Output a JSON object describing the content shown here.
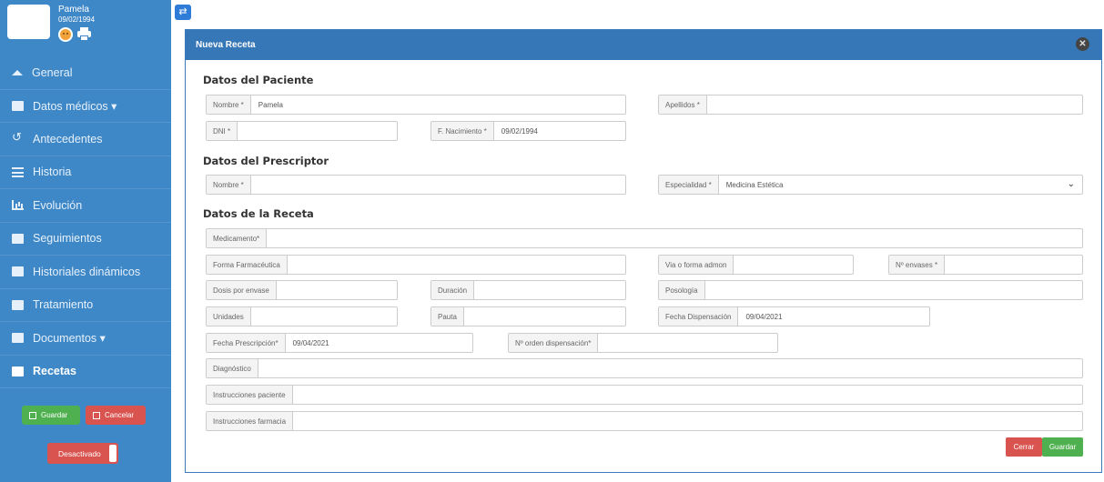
{
  "sidebar": {
    "patient_name": "Pamela",
    "patient_dob": "09/02/1994",
    "nav": [
      {
        "label": "General",
        "icon": "home-icon"
      },
      {
        "label": "Datos médicos ▾",
        "icon": "medkit-icon"
      },
      {
        "label": "Antecedentes",
        "icon": "history-icon"
      },
      {
        "label": "Historia",
        "icon": "list-icon"
      },
      {
        "label": "Evolución",
        "icon": "bar-chart-icon"
      },
      {
        "label": "Seguimientos",
        "icon": "calendar-icon"
      },
      {
        "label": "Historiales dinámicos",
        "icon": "file-icon"
      },
      {
        "label": "Tratamiento",
        "icon": "file-icon"
      },
      {
        "label": "Documentos ▾",
        "icon": "file-icon"
      },
      {
        "label": "Recetas",
        "icon": "card-icon"
      }
    ],
    "save_label": "Guardar",
    "cancel_label": "Cancelar",
    "toggle_label": "Desactivado"
  },
  "modal": {
    "title": "Nueva Receta",
    "section_patient": "Datos del Paciente",
    "section_prescriber": "Datos del Prescriptor",
    "section_recipe": "Datos de la Receta",
    "fields": {
      "nombre_label": "Nombre *",
      "nombre_value": "Pamela",
      "apellidos_label": "Apellidos *",
      "dni_label": "DNI *",
      "fnac_label": "F. Nacimiento *",
      "fnac_value": "09/02/1994",
      "presc_nombre_label": "Nombre *",
      "especialidad_label": "Especialidad *",
      "especialidad_value": "Medicina Estética",
      "medicamento_label": "Medicamento*",
      "forma_label": "Forma Farmacéutica",
      "via_label": "Via o forma admon",
      "envases_label": "Nº envases *",
      "dosis_label": "Dosis por envase",
      "duracion_label": "Duración",
      "posologia_label": "Posología",
      "unidades_label": "Unidades",
      "pauta_label": "Pauta",
      "fdisp_label": "Fecha Dispensación",
      "fdisp_value": "09/04/2021",
      "fpresc_label": "Fecha Prescripción*",
      "fpresc_value": "09/04/2021",
      "orden_label": "Nº orden dispensación*",
      "diagnostico_label": "Diagnóstico",
      "instr_paciente_label": "Instrucciones paciente",
      "instr_farmacia_label": "Instrucciones farmacia"
    },
    "close_label": "Cerrar",
    "save_label": "Guardar"
  },
  "colors": {
    "sidebar": "#3f88c8",
    "header": "#3577b7",
    "green": "#4fb050",
    "red": "#d9534f"
  }
}
